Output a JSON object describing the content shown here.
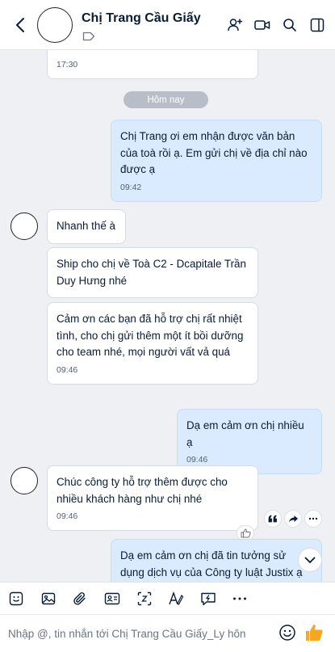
{
  "header": {
    "title": "Chị Trang Cầu Giấy",
    "icons": [
      "back-arrow-icon",
      "tag-icon",
      "add-member-icon",
      "video-call-icon",
      "search-icon",
      "sidebar-toggle-icon"
    ]
  },
  "chat": {
    "partial_message": {
      "time": "17:30"
    },
    "date_divider": "Hôm nay",
    "messages": [
      {
        "sender": "me",
        "text": "Chị Trang ơi em nhận được văn bản của toà rồi ạ. Em gửi chị về địa chỉ nào được ạ",
        "time": "09:42"
      },
      {
        "sender": "them",
        "text": "Nhanh thế à"
      },
      {
        "sender": "them",
        "text": "Ship cho chị về Toà C2 - Dcapitale Trần Duy Hưng nhé"
      },
      {
        "sender": "them",
        "text": "Cảm ơn các bạn đã hỗ trợ chị rất nhiệt tình, cho chị gửi thêm một ít bồi dưỡng cho team nhé, mọi người vất vả quá",
        "time": "09:46"
      },
      {
        "sender": "me",
        "text": "Dạ em cảm ơn chị nhiều ạ",
        "time": "09:46"
      },
      {
        "sender": "them",
        "text": "Chúc công ty hỗ trợ thêm được cho nhiều khách hàng như chị nhé",
        "time": "09:46"
      },
      {
        "sender": "me",
        "text": "Dạ em cảm ơn chị đã tin tưởng sử dụng dịch vụ của Công ty luật Justix ạ"
      }
    ]
  },
  "composer": {
    "placeholder": "Nhập @, tin nhắn tới Chị Trang Cầu Giấy_Ly hôn",
    "toolbar_icons": [
      "sticker-icon",
      "image-icon",
      "attachment-icon",
      "contact-card-icon",
      "screenshot-icon",
      "text-format-icon",
      "quick-message-icon",
      "more-icon"
    ]
  },
  "colors": {
    "my_bubble": "#dbebff",
    "their_bubble": "#ffffff",
    "background": "#eef0f4",
    "accent": "#0068ff",
    "like": "#f5a623"
  }
}
